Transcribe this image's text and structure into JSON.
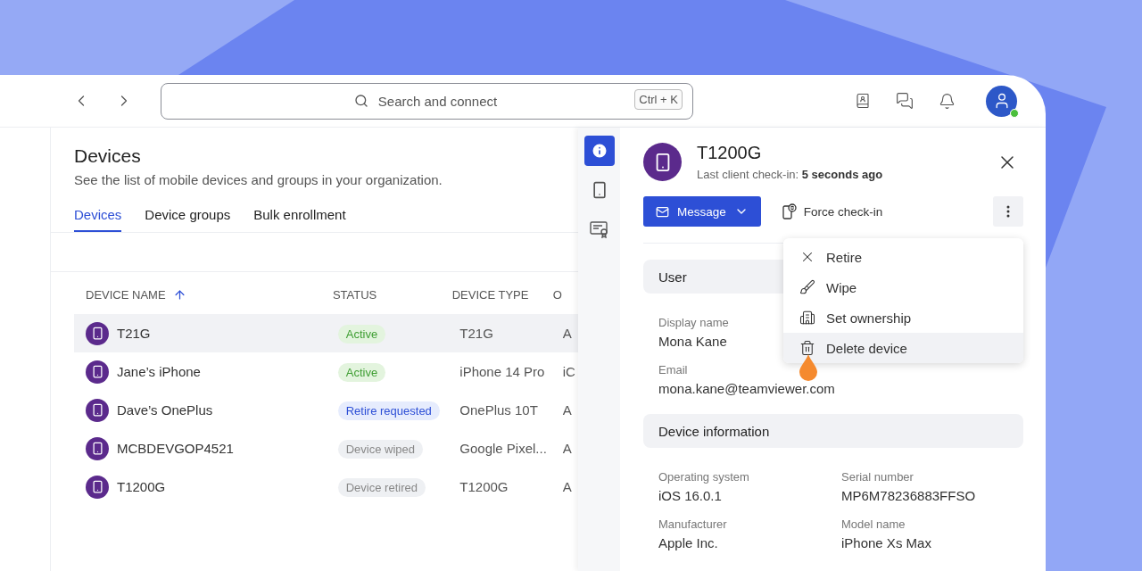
{
  "search": {
    "placeholder": "Search and connect",
    "shortcut": "Ctrl + K"
  },
  "avatar": {
    "online": true
  },
  "page": {
    "title": "Devices",
    "subtitle": "See the list of mobile devices and groups in your organization."
  },
  "tabs": [
    {
      "label": "Devices",
      "selected": true
    },
    {
      "label": "Device groups",
      "selected": false
    },
    {
      "label": "Bulk enrollment",
      "selected": false
    }
  ],
  "table": {
    "columns": [
      {
        "label": "DEVICE NAME",
        "sorted": true
      },
      {
        "label": "STATUS",
        "sorted": false
      },
      {
        "label": "DEVICE TYPE",
        "sorted": false
      },
      {
        "label": "O",
        "sorted": false
      }
    ],
    "rows": [
      {
        "name": "T21G",
        "status": {
          "text": "Active",
          "kind": "active"
        },
        "device_type": "T21G",
        "column_4": "A",
        "selected": true
      },
      {
        "name": "Jane’s iPhone",
        "status": {
          "text": "Active",
          "kind": "active"
        },
        "device_type": "iPhone 14 Pro",
        "column_4": "iC",
        "selected": false
      },
      {
        "name": "Dave’s OnePlus",
        "status": {
          "text": "Retire requested",
          "kind": "pending"
        },
        "device_type": "OnePlus 10T",
        "column_4": "A",
        "selected": false
      },
      {
        "name": "MCBDEVGOP4521",
        "status": {
          "text": "Device wiped",
          "kind": "inactive"
        },
        "device_type": "Google Pixel...",
        "column_4": "A",
        "selected": false
      },
      {
        "name": "T1200G",
        "status": {
          "text": "Device retired",
          "kind": "inactive"
        },
        "device_type": "T1200G",
        "column_4": "A",
        "selected": false
      }
    ]
  },
  "detail": {
    "rail": [
      {
        "kind": "info",
        "selected": true
      },
      {
        "kind": "phone",
        "selected": false
      },
      {
        "kind": "certificate",
        "selected": false
      }
    ],
    "title": "T1200G",
    "checkin": "Last client check-in: **5 seconds ago**",
    "message_button": "Message",
    "force_button": "Force check-in",
    "menu": {
      "open": true,
      "items": [
        {
          "label": "Retire",
          "kind": "retire",
          "selected": false
        },
        {
          "label": "Wipe",
          "kind": "wipe",
          "selected": false
        },
        {
          "label": "Set ownership",
          "kind": "ownership",
          "selected": false
        },
        {
          "label": "Delete device",
          "kind": "delete",
          "selected": true
        }
      ]
    },
    "sections": [
      {
        "title": "User",
        "kind": "single",
        "fields": [
          {
            "label": "Display name",
            "value": "Mona Kane"
          },
          {
            "label": "Email",
            "value": "mona.kane@teamviewer.com"
          }
        ]
      },
      {
        "title": "Device information",
        "kind": "double",
        "fields": [
          {
            "label": "Operating system",
            "value": "iOS 16.0.1"
          },
          {
            "label": "Serial number",
            "value": "MP6M78236883FFSO"
          },
          {
            "label": "Manufacturer",
            "value": "Apple Inc."
          },
          {
            "label": "Model name",
            "value": "iPhone Xs Max"
          }
        ]
      }
    ]
  }
}
